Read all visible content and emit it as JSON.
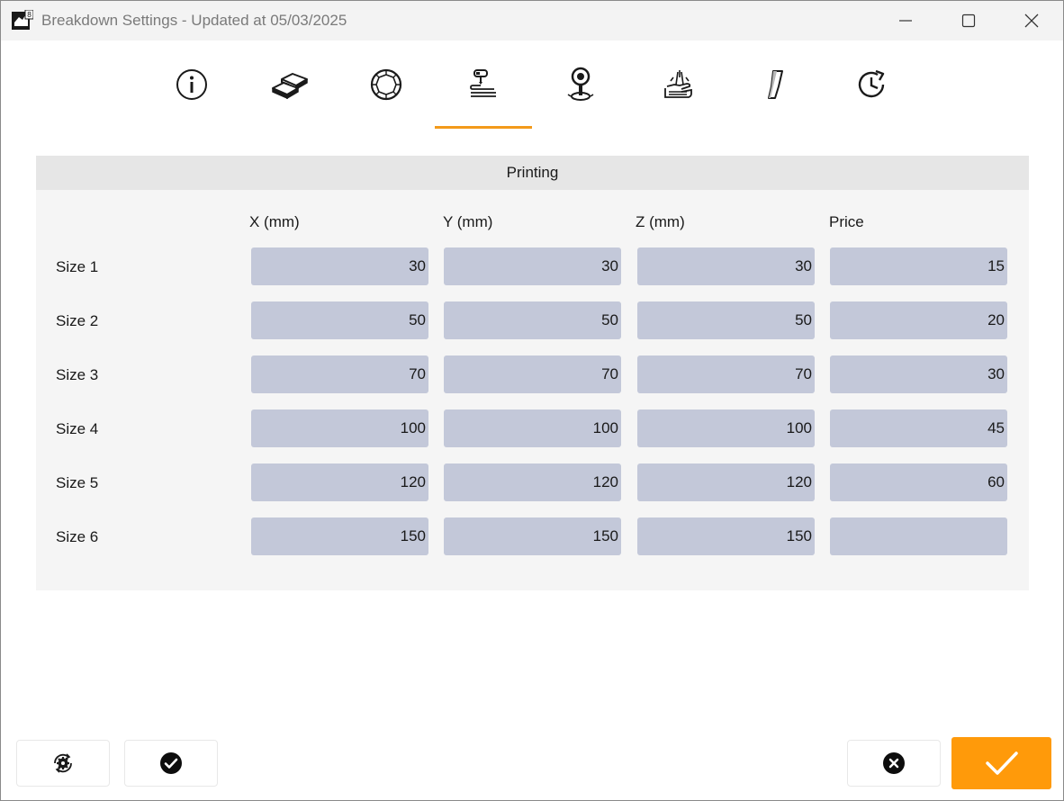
{
  "window": {
    "title": "Breakdown Settings - Updated at 05/03/2025"
  },
  "titlebar_buttons": [
    "minimize-icon",
    "maximize-icon",
    "close-icon"
  ],
  "tabs": [
    {
      "icon": "info-icon",
      "active": false
    },
    {
      "icon": "metal-bars-icon",
      "active": false
    },
    {
      "icon": "gem-icon",
      "active": false
    },
    {
      "icon": "printing-icon",
      "active": true
    },
    {
      "icon": "location-pin-icon",
      "active": false
    },
    {
      "icon": "hand-setting-icon",
      "active": false
    },
    {
      "icon": "polishing-icon",
      "active": false
    },
    {
      "icon": "clock-refresh-icon",
      "active": false
    }
  ],
  "panel": {
    "title": "Printing",
    "columns": [
      "X (mm)",
      "Y (mm)",
      "Z (mm)",
      "Price"
    ],
    "rows": [
      {
        "label": "Size 1",
        "values": [
          "30",
          "30",
          "30",
          "15"
        ]
      },
      {
        "label": "Size 2",
        "values": [
          "50",
          "50",
          "50",
          "20"
        ]
      },
      {
        "label": "Size 3",
        "values": [
          "70",
          "70",
          "70",
          "30"
        ]
      },
      {
        "label": "Size 4",
        "values": [
          "100",
          "100",
          "100",
          "45"
        ]
      },
      {
        "label": "Size 5",
        "values": [
          "120",
          "120",
          "120",
          "60"
        ]
      },
      {
        "label": "Size 6",
        "values": [
          "150",
          "150",
          "150",
          ""
        ]
      }
    ]
  },
  "footer": {
    "left_buttons": [
      "settings-refresh-icon",
      "check-circle-icon"
    ],
    "right_buttons": [
      "cancel-circle-icon",
      "confirm-check-icon"
    ]
  },
  "colors": {
    "accent": "#ff9a0a",
    "active_tab_underline": "#f39a1a",
    "input_bg": "#c3c8d9",
    "panel_bg": "#f5f5f5",
    "panel_header_bg": "#e6e6e6"
  }
}
